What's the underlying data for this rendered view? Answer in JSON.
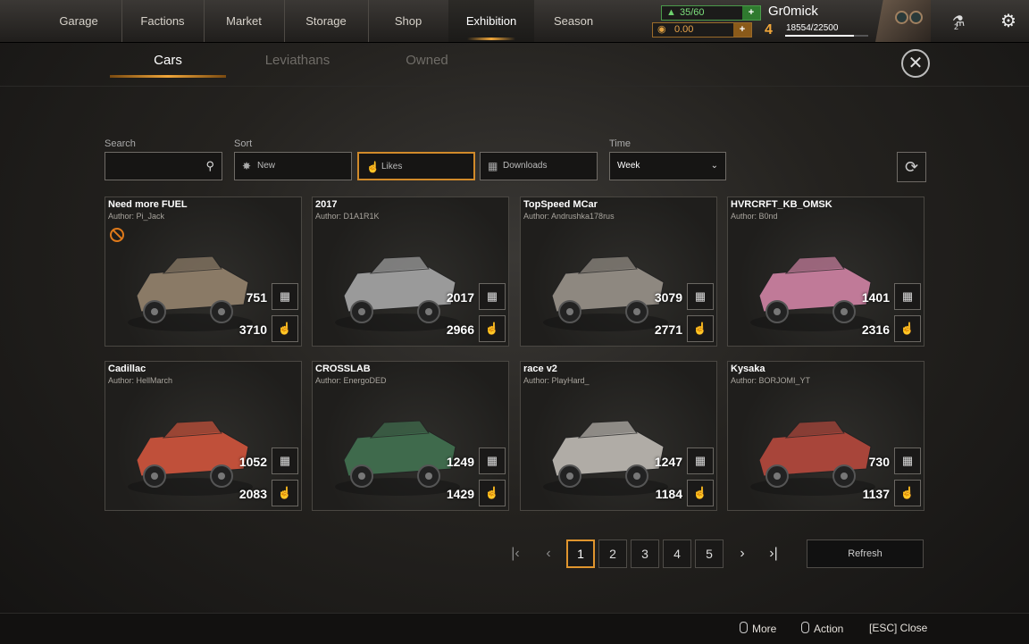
{
  "nav": {
    "tabs": [
      "Garage",
      "Factions",
      "Market",
      "Storage",
      "Shop",
      "Exhibition",
      "Season"
    ],
    "active": "Exhibition"
  },
  "resources": {
    "fuel": "35/60",
    "coins": "0.00",
    "plus": "+"
  },
  "player": {
    "name": "Gr0mick",
    "level": "4",
    "xp": "18554/22500",
    "xp_fraction": 0.825,
    "badge_count": "2"
  },
  "subtabs": [
    "Cars",
    "Leviathans",
    "Owned"
  ],
  "filters": {
    "search_label": "Search",
    "search_value": "",
    "sort_label": "Sort",
    "sort_options": [
      "New",
      "Likes",
      "Downloads"
    ],
    "sort_selected": "Likes",
    "time_label": "Time",
    "time_value": "Week"
  },
  "cards": [
    {
      "title": "Need more FUEL",
      "author": "Author: Pi_Jack",
      "downloads": "751",
      "likes": "3710",
      "banned": true,
      "color": "#8a7a66"
    },
    {
      "title": "2017",
      "author": "Author: D1A1R1K",
      "downloads": "2017",
      "likes": "2966",
      "banned": false,
      "color": "#9a9a9a"
    },
    {
      "title": "TopSpeed MCar",
      "author": "Author: Andrushka178rus",
      "downloads": "3079",
      "likes": "2771",
      "banned": false,
      "color": "#8e8880"
    },
    {
      "title": "HVRCRFT_KB_OMSK",
      "author": "Author: B0nd",
      "downloads": "1401",
      "likes": "2316",
      "banned": false,
      "color": "#c07a98"
    },
    {
      "title": "Cadillac",
      "author": "Author: HellMarch",
      "downloads": "1052",
      "likes": "2083",
      "banned": false,
      "color": "#c0503a"
    },
    {
      "title": "CROSSLAB",
      "author": "Author: EnergoDED",
      "downloads": "1249",
      "likes": "1429",
      "banned": false,
      "color": "#3f6a4c"
    },
    {
      "title": "race v2",
      "author": "Author: PlayHard_",
      "downloads": "1247",
      "likes": "1184",
      "banned": false,
      "color": "#b0aca6"
    },
    {
      "title": "Kysaka",
      "author": "Author: BORJOMI_YT",
      "downloads": "730",
      "likes": "1137",
      "banned": false,
      "color": "#a8453a"
    }
  ],
  "pagination": {
    "pages": [
      "1",
      "2",
      "3",
      "4",
      "5"
    ],
    "current": "1",
    "refresh_label": "Refresh"
  },
  "footer": {
    "more": "More",
    "action": "Action",
    "close": "[ESC] Close"
  }
}
